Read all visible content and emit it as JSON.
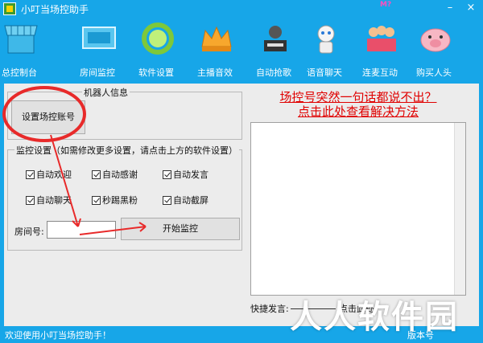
{
  "window": {
    "title": "小叮当场控助手",
    "badge": "M?",
    "minimize": "–",
    "close": "×"
  },
  "toolbar": [
    {
      "label": "总控制台",
      "icon": "store-awning-icon"
    },
    {
      "label": "房间监控",
      "icon": "monitor-icon"
    },
    {
      "label": "软件设置",
      "icon": "gear-ring-icon"
    },
    {
      "label": "主播音效",
      "icon": "crown-icon"
    },
    {
      "label": "自动抢歌",
      "icon": "music-robot-icon"
    },
    {
      "label": "语音聊天",
      "icon": "headset-robot-icon"
    },
    {
      "label": "连麦互动",
      "icon": "crowd-icon"
    },
    {
      "label": "购买人头",
      "icon": "pig-icon"
    }
  ],
  "robot_group": {
    "title": "机器人信息",
    "set_account": "设置场控账号"
  },
  "monitor_group": {
    "title": "监控设置（如需修改更多设置，请点击上方的软件设置）",
    "checks": [
      "自动欢迎",
      "自动感谢",
      "自动发言",
      "自动聊天",
      "秒踢黑粉",
      "自动截屏"
    ],
    "room_label": "房间号:",
    "room_value": "",
    "start_btn": "开始监控"
  },
  "notice": {
    "line1": "场控号突然一句话都说不出？",
    "line2": "点击此处查看解决方法"
  },
  "bottom": {
    "quick_label": "快捷发言:",
    "hint": "点击此处"
  },
  "status": {
    "left": "欢迎使用小叮当场控助手！",
    "version": "版本号"
  },
  "watermark": "人人软件园",
  "colors": {
    "accent": "#17a6e8",
    "annotation": "#e82a2a"
  }
}
